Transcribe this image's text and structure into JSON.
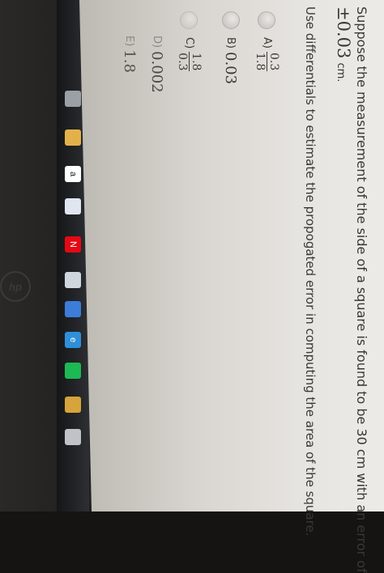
{
  "question": {
    "line1": "Suppose the measurement of the side of a square is found to be 30 cm with an error of",
    "error_sign": "±",
    "error_value": "0.03",
    "error_unit": "cm.",
    "line3": "Use differentials to estimate the propogated error in computing the area of the square."
  },
  "options": [
    {
      "label": "A)",
      "numerator": "0.3",
      "denominator": "1.8"
    },
    {
      "label": "B)",
      "value": "0.03"
    },
    {
      "label": "C)",
      "numerator": "1.8",
      "denominator": "0.3"
    },
    {
      "label": "D)",
      "value": "0.002"
    },
    {
      "label": "E)",
      "value": "1.8"
    }
  ],
  "taskbar": {
    "icons": [
      {
        "name": "task-view-icon",
        "color": "#9aa0a6"
      },
      {
        "name": "file-explorer-icon",
        "color": "#e2b24a"
      },
      {
        "name": "amazon-icon",
        "color": "#ffffff",
        "glyph": "a"
      },
      {
        "name": "dropbox-icon",
        "color": "#dfe6f0"
      },
      {
        "name": "netflix-icon",
        "color": "#e50914",
        "glyph": "N"
      },
      {
        "name": "weather-icon",
        "color": "#cfd6de"
      },
      {
        "name": "store-icon",
        "color": "#3b7dd8"
      },
      {
        "name": "edge-icon",
        "color": "#2f8fd8",
        "glyph": "e"
      },
      {
        "name": "spotify-icon",
        "color": "#1db954"
      },
      {
        "name": "chrome-icon",
        "color": "#d6a43a"
      },
      {
        "name": "calculator-icon",
        "color": "#bfc3c8"
      }
    ]
  },
  "bezel": {
    "logo": "hp"
  }
}
